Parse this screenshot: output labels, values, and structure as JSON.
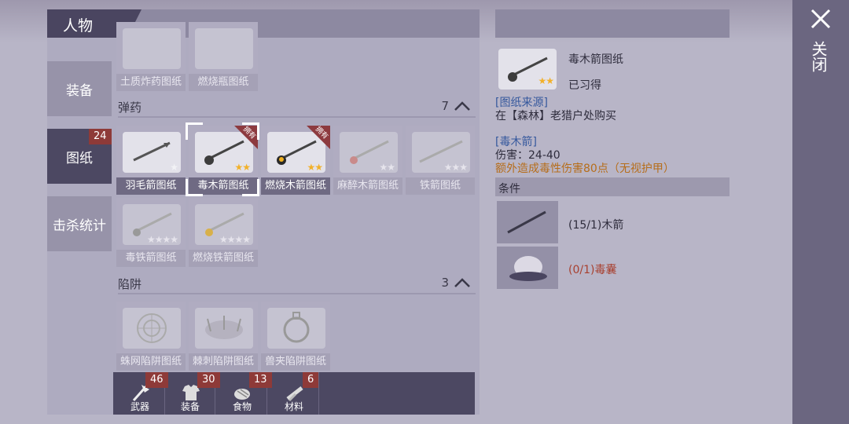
{
  "header": {
    "title": "人物"
  },
  "side_tabs": [
    {
      "label": "装备",
      "active": false
    },
    {
      "label": "图纸",
      "active": true,
      "badge": "24"
    },
    {
      "label": "击杀统计",
      "active": false
    }
  ],
  "list": {
    "top_row": [
      {
        "label": "土质炸药图纸",
        "dim": true
      },
      {
        "label": "燃烧瓶图纸",
        "dim": true
      }
    ],
    "sections": [
      {
        "title": "弹药",
        "count": "7",
        "items": [
          {
            "label": "羽毛箭图纸",
            "stars": "★",
            "owned": false,
            "dim": false
          },
          {
            "label": "毒木箭图纸",
            "stars": "★★",
            "owned": true,
            "dim": false,
            "selected": true
          },
          {
            "label": "燃烧木箭图纸",
            "stars": "★★",
            "owned": true,
            "dim": false
          },
          {
            "label": "麻醉木箭图纸",
            "stars": "★★",
            "owned": false,
            "dim": true
          },
          {
            "label": "铁箭图纸",
            "stars": "★★★",
            "owned": false,
            "dim": true
          },
          {
            "label": "毒铁箭图纸",
            "stars": "★★★★",
            "owned": false,
            "dim": true
          },
          {
            "label": "燃烧铁箭图纸",
            "stars": "★★★★",
            "owned": false,
            "dim": true
          }
        ]
      },
      {
        "title": "陷阱",
        "count": "3",
        "items": [
          {
            "label": "蛛网陷阱图纸",
            "dim": true
          },
          {
            "label": "棘刺陷阱图纸",
            "dim": true
          },
          {
            "label": "兽夹陷阱图纸",
            "dim": true
          }
        ]
      }
    ],
    "owned_tag": "拥有"
  },
  "bottom_tabs": [
    {
      "label": "武器",
      "badge": "46",
      "icon": "axe-icon"
    },
    {
      "label": "装备",
      "badge": "30",
      "icon": "shirt-icon"
    },
    {
      "label": "食物",
      "badge": "13",
      "icon": "meat-icon"
    },
    {
      "label": "材料",
      "badge": "6",
      "icon": "wood-icon"
    }
  ],
  "detail": {
    "name": "毒木箭图纸",
    "status": "已习得",
    "stars": "★★",
    "source_title": "[图纸来源]",
    "source_text": "在【森林】老猎户处购买",
    "item_title": "[毒木箭]",
    "damage": "伤害：24-40",
    "extra": "额外造成毒性伤害80点（无视护甲）",
    "conditions_label": "条件",
    "materials": [
      {
        "text": "(15/1)木箭",
        "ok": true,
        "icon": "wooden-arrow-icon"
      },
      {
        "text": "(0/1)毒囊",
        "ok": false,
        "icon": "poison-sac-icon"
      }
    ]
  },
  "close": {
    "label": "关闭"
  },
  "colors": {
    "owned": "#8d3a3f",
    "star": "#f2b12a",
    "missing": "#a8402f",
    "link": "#35589d",
    "effect": "#b66d1a"
  }
}
